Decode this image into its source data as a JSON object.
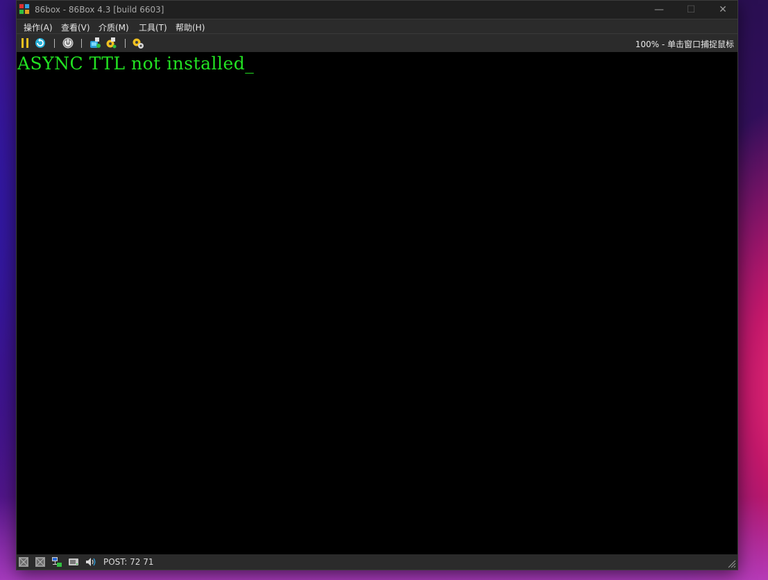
{
  "window": {
    "title": "86box - 86Box 4.3 [build 6603]",
    "controls": {
      "minimize": "—",
      "maximize": "☐",
      "close": "✕"
    }
  },
  "menubar": {
    "items": [
      {
        "label": "操作(A)"
      },
      {
        "label": "查看(V)"
      },
      {
        "label": "介质(M)"
      },
      {
        "label": "工具(T)"
      },
      {
        "label": "帮助(H)"
      }
    ]
  },
  "toolbar": {
    "buttons": [
      {
        "icon": "pause-icon"
      },
      {
        "icon": "reset-icon"
      },
      {
        "icon": "power-icon"
      },
      {
        "icon": "ctrl-alt-del-icon"
      },
      {
        "icon": "ctrl-alt-esc-icon"
      },
      {
        "icon": "settings-icon"
      }
    ],
    "status": "100% - 单击窗口捕捉鼠标"
  },
  "screen": {
    "text": "ASYNC TTL not installed_",
    "text_color": "#22e222"
  },
  "statusbar": {
    "icons": [
      "floppy-drive-1-icon",
      "floppy-drive-2-icon",
      "network-icon",
      "hard-disk-icon",
      "sound-icon"
    ],
    "post": "POST: 72 71"
  }
}
